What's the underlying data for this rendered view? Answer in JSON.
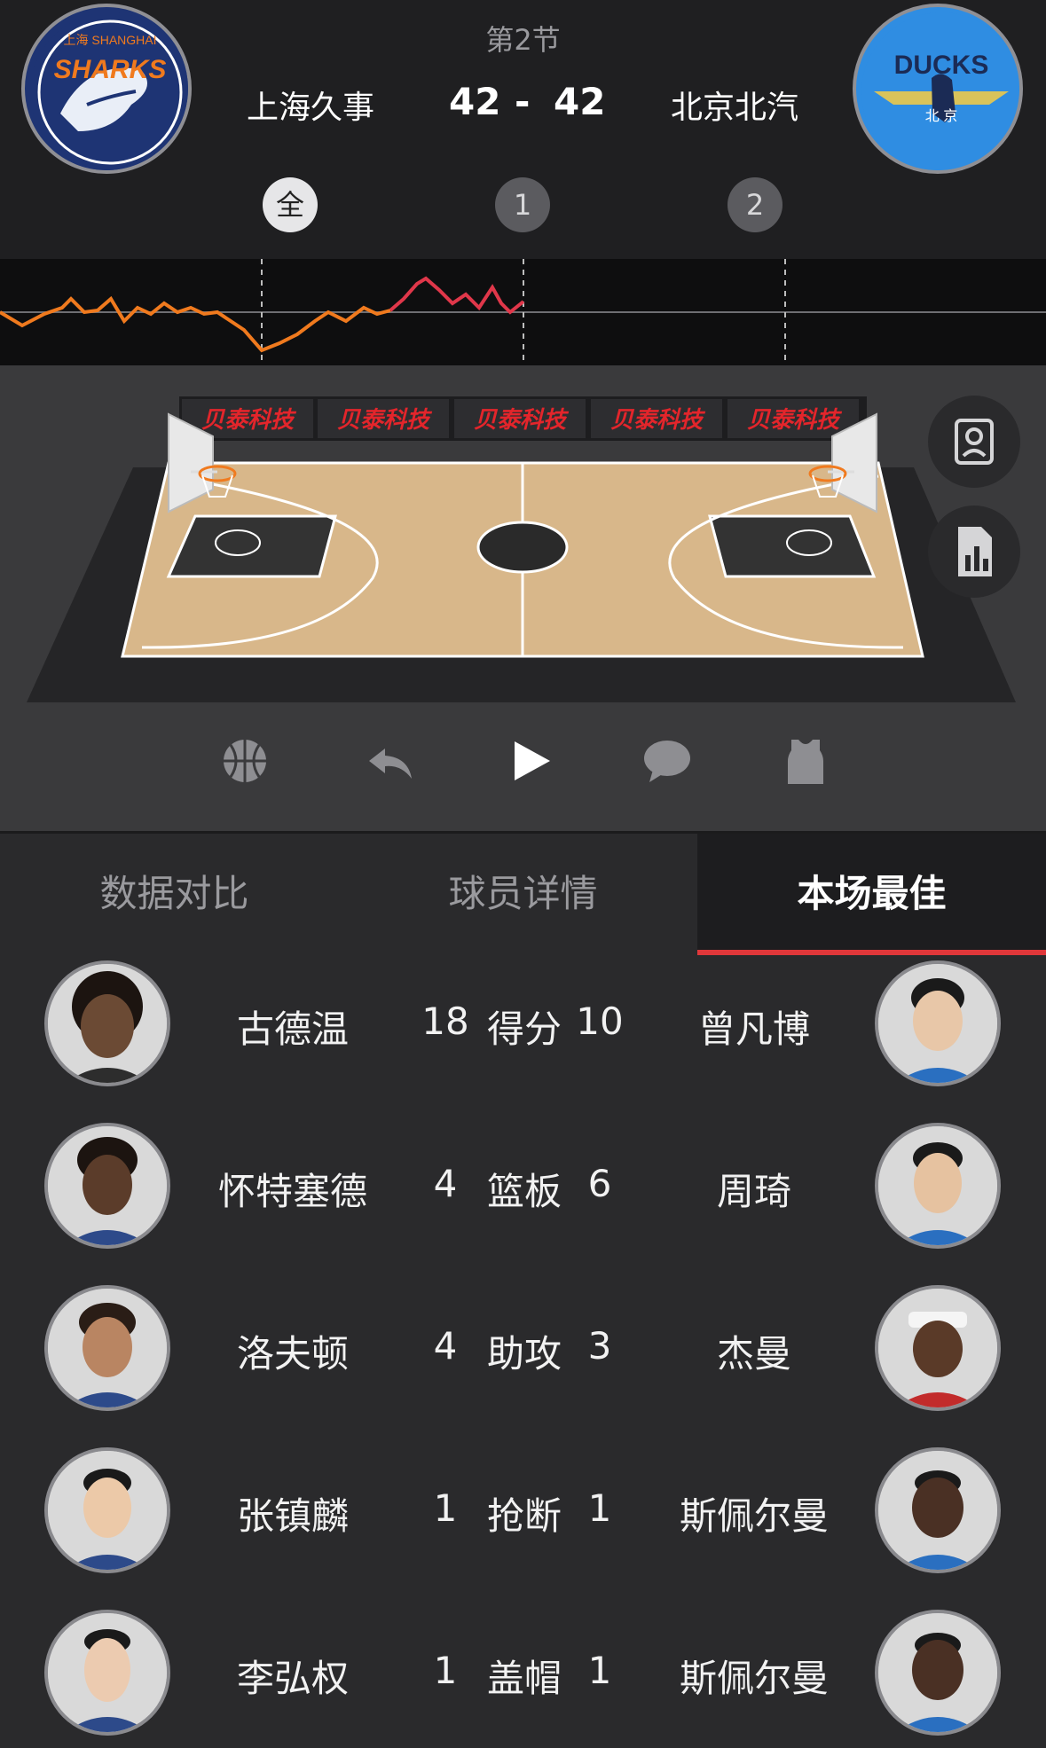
{
  "header": {
    "period": "第2节",
    "home_team": "上海久事",
    "away_team": "北京北汽",
    "home_score": "42",
    "separator": "-",
    "away_score": "42",
    "home_logo_text": "SHARKS",
    "home_logo_sub": "上海 SHANGHAI",
    "away_logo_text": "DUCKS",
    "away_logo_sub": "北 京"
  },
  "period_buttons": [
    "全",
    "1",
    "2"
  ],
  "court": {
    "sponsor_boards": [
      "贝泰科技",
      "贝泰科技",
      "贝泰科技",
      "贝泰科技",
      "贝泰科技"
    ]
  },
  "controls": {
    "icons": [
      "basketball-icon",
      "replay-icon",
      "play-icon",
      "comment-icon",
      "jersey-icon"
    ]
  },
  "side_buttons": [
    "player-card-icon",
    "stats-chart-icon"
  ],
  "tabs": [
    "数据对比",
    "球员详情",
    "本场最佳"
  ],
  "leaders": [
    {
      "left_name": "古德温",
      "left_value": "18",
      "stat": "得分",
      "right_value": "10",
      "right_name": "曾凡博"
    },
    {
      "left_name": "怀特塞德",
      "left_value": "4",
      "stat": "篮板",
      "right_value": "6",
      "right_name": "周琦"
    },
    {
      "left_name": "洛夫顿",
      "left_value": "4",
      "stat": "助攻",
      "right_value": "3",
      "right_name": "杰曼"
    },
    {
      "left_name": "张镇麟",
      "left_value": "1",
      "stat": "抢断",
      "right_value": "1",
      "right_name": "斯佩尔曼"
    },
    {
      "left_name": "李弘权",
      "left_value": "1",
      "stat": "盖帽",
      "right_value": "1",
      "right_name": "斯佩尔曼"
    }
  ],
  "colors": {
    "accent": "#e0373a",
    "momentum_home": "#f07a1e",
    "momentum_away": "#e0374a"
  }
}
